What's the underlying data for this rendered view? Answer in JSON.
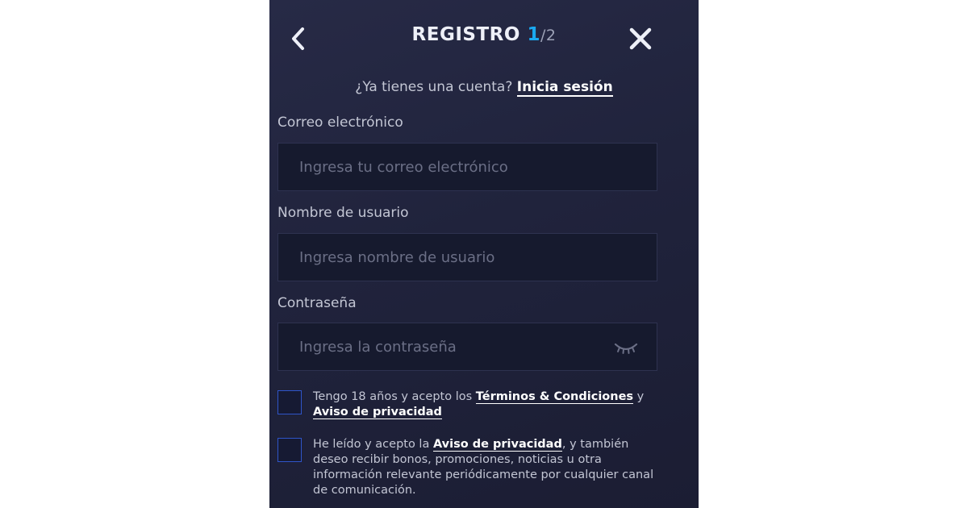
{
  "header": {
    "title": "REGISTRO",
    "step_current": "1",
    "step_total": "/2",
    "back_icon": "chevron-left-icon",
    "close_icon": "close-icon"
  },
  "login_prompt": {
    "text": "¿Ya tienes una cuenta?",
    "link": "Inicia sesión"
  },
  "form": {
    "email": {
      "label": "Correo electrónico",
      "placeholder": "Ingresa tu correo electrónico",
      "value": ""
    },
    "username": {
      "label": "Nombre de usuario",
      "placeholder": "Ingresa nombre de usuario",
      "value": ""
    },
    "password": {
      "label": "Contraseña",
      "placeholder": "Ingresa la contraseña",
      "value": "",
      "toggle_icon": "eye-closed-icon"
    }
  },
  "consents": {
    "terms": {
      "checked": false,
      "text_before": "Tengo 18 años y acepto los",
      "link1": "Términos & Condiciones",
      "text_middle": "y",
      "link2": "Aviso de privacidad"
    },
    "marketing": {
      "checked": false,
      "text_before": "He leído y acepto la",
      "link": "Aviso de privacidad",
      "text_after": ", y también deseo recibir bonos, promociones, noticias u otra información relevante periódicamente por cualquier canal de comunicación."
    }
  },
  "colors": {
    "panel_background": "#22253f",
    "field_background": "#161a2e",
    "step_accent": "#1aa8f0",
    "checkbox_border": "#2f55c9"
  }
}
